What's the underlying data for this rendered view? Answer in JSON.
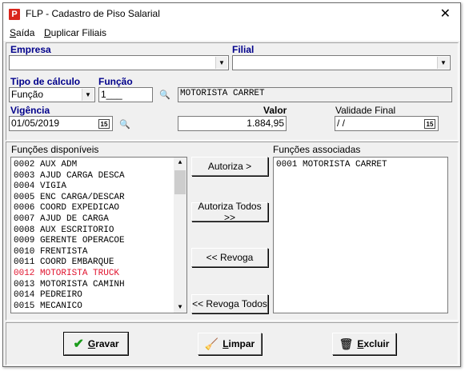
{
  "window": {
    "title": "FLP - Cadastro de Piso Salarial",
    "app_icon_letter": "P",
    "close_glyph": "✕"
  },
  "menu": {
    "items": [
      {
        "label_first": "S",
        "label_rest": "aída"
      },
      {
        "label_first": "D",
        "label_rest": "uplicar Filiais"
      }
    ]
  },
  "form": {
    "empresa": {
      "label": "Empresa",
      "value": ""
    },
    "filial": {
      "label": "Filial",
      "value": ""
    },
    "tipo_calculo": {
      "label": "Tipo de cálculo",
      "value": "Função"
    },
    "funcao": {
      "label": "Função",
      "code": "1___",
      "name": "MOTORISTA CARRET"
    },
    "vigencia": {
      "label": "Vigência",
      "value": "01/05/2019"
    },
    "valor": {
      "label": "Valor",
      "value": "1.884,95"
    },
    "validade_final": {
      "label": "Validade Final",
      "value": " / /"
    }
  },
  "lists": {
    "disponiveis": {
      "label": "Funções disponíveis",
      "items": [
        "0002 AUX ADM",
        "0003 AJUD CARGA DESCA",
        "0004 VIGIA",
        "0005 ENC CARGA/DESCAR",
        "0006 COORD EXPEDICAO",
        "0007 AJUD DE CARGA",
        "0008 AUX ESCRITORIO",
        "0009 GERENTE OPERACOE",
        "0010 FRENTISTA",
        "0011 COORD EMBARQUE",
        "0012 MOTORISTA TRUCK",
        "0013 MOTORISTA CAMINH",
        "0014 PEDREIRO",
        "0015 MECANICO"
      ],
      "highlight_index": 10,
      "highlight_color": "#e0142f"
    },
    "associadas": {
      "label": "Funções associadas",
      "items": [
        "0001 MOTORISTA CARRET"
      ]
    }
  },
  "transfer_buttons": {
    "autoriza": "Autoriza >",
    "autoriza_todos": "Autoriza Todos >>",
    "revoga": "<< Revoga",
    "revoga_todos": "<< Revoga Todos"
  },
  "actions": {
    "gravar": {
      "first": "G",
      "rest": "ravar",
      "icon": "check-icon"
    },
    "limpar": {
      "first": "L",
      "rest": "impar",
      "icon": "broom-icon"
    },
    "excluir": {
      "first": "E",
      "rest": "xcluir",
      "icon": "trash-icon"
    }
  },
  "colors": {
    "label_accent": "#00008b",
    "highlight": "#e0142f",
    "app_icon": "#d9261c"
  }
}
